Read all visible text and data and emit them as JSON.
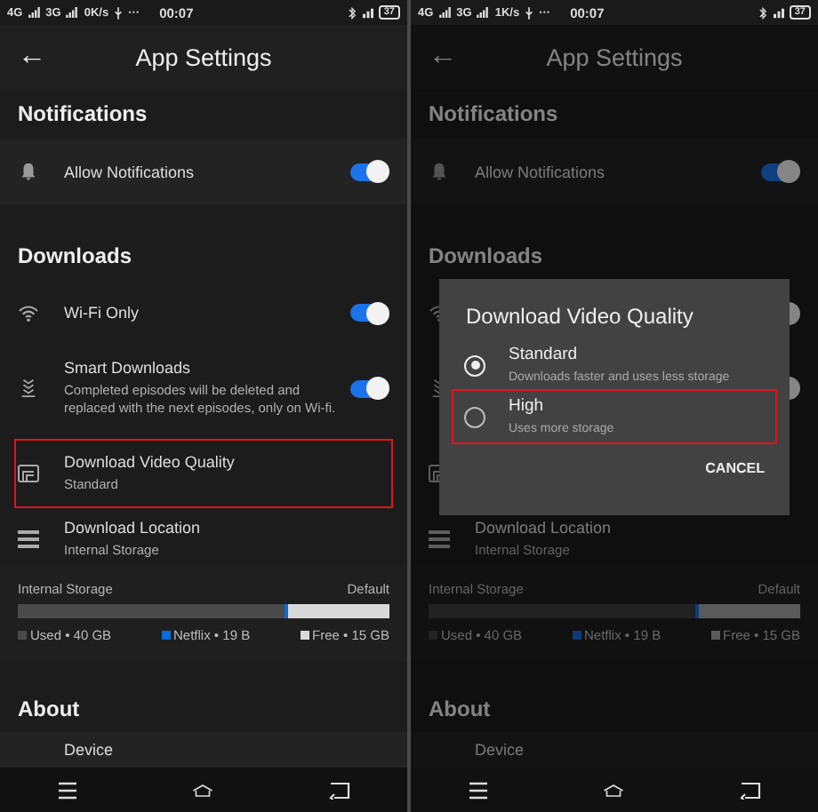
{
  "screens": [
    {
      "status": {
        "network_1": "4G",
        "network_2": "3G",
        "speed": "0K/s",
        "more": "···",
        "time": "00:07",
        "battery": "37"
      },
      "header": {
        "back": "←",
        "title": "App Settings"
      },
      "notifications": {
        "heading": "Notifications",
        "rows": [
          {
            "kind": "bell",
            "label": "Allow Notifications",
            "on": true,
            "highlighted": false
          }
        ]
      },
      "downloads": {
        "heading": "Downloads",
        "rows": [
          {
            "kind": "wifi",
            "label": "Wi-Fi Only",
            "on": true,
            "highlighted": false
          },
          {
            "kind": "smart",
            "label": "Smart Downloads",
            "description": "Completed episodes will be deleted and replaced with the next episodes, only on Wi-fi.",
            "on": true,
            "highlighted": false
          },
          {
            "kind": "quality",
            "label": "Download Video Quality",
            "description": "Standard",
            "highlighted": true
          },
          {
            "kind": "location",
            "label": "Download Location",
            "description": "Internal Storage",
            "highlighted": false
          }
        ]
      },
      "storage": {
        "label": "Internal Storage",
        "default_label": "Default",
        "used": {
          "level": 0.72
        },
        "netflix": {
          "level": 0.005
        },
        "legend": [
          {
            "label": "Used • 40 GB",
            "color": "#4a4a4a"
          },
          {
            "label": "Netflix • 19 B",
            "color": "#0a6cd6"
          },
          {
            "label": "Free • 15 GB",
            "color": "#d9d9d9"
          }
        ]
      },
      "about": {
        "heading": "About",
        "rows": [
          {
            "label": "Device"
          }
        ]
      },
      "dimmed": false
    },
    {
      "status": {
        "network_1": "4G",
        "network_2": "3G",
        "speed": "1K/s",
        "more": "···",
        "time": "00:07",
        "battery": "37"
      },
      "header": {
        "back": "←",
        "title": "App Settings"
      },
      "notifications": {
        "heading": "Notifications",
        "rows": [
          {
            "kind": "bell",
            "label": "Allow Notifications",
            "on": true,
            "highlighted": false
          }
        ]
      },
      "downloads": {
        "heading": "Downloads",
        "rows": [
          {
            "kind": "wifi",
            "on": true
          },
          {
            "kind": "smart",
            "on": true
          },
          {
            "kind": "quality"
          },
          {
            "kind": "location",
            "label": "Download Location",
            "description": "Internal Storage",
            "highlighted": false
          }
        ]
      },
      "storage": {
        "label": "Internal Storage",
        "default_label": "Default",
        "used": {
          "level": 0.72
        },
        "netflix": {
          "level": 0.005
        },
        "legend": [
          {
            "label": "Used • 40 GB",
            "color": "#222222"
          },
          {
            "label": "Netflix • 19 B",
            "color": "#0b3c78"
          },
          {
            "label": "Free • 15 GB",
            "color": "#5a5a5a"
          }
        ]
      },
      "about": {
        "heading": "About",
        "rows": [
          {
            "label": "Device"
          }
        ]
      },
      "dimmed": true,
      "dialog": {
        "title": "Download Video Quality",
        "options": [
          {
            "label": "Standard",
            "description": "Downloads faster and uses less storage",
            "selected": true,
            "highlighted": false
          },
          {
            "label": "High",
            "description": "Uses more storage",
            "selected": false,
            "highlighted": true
          }
        ],
        "button": "CANCEL"
      }
    }
  ]
}
